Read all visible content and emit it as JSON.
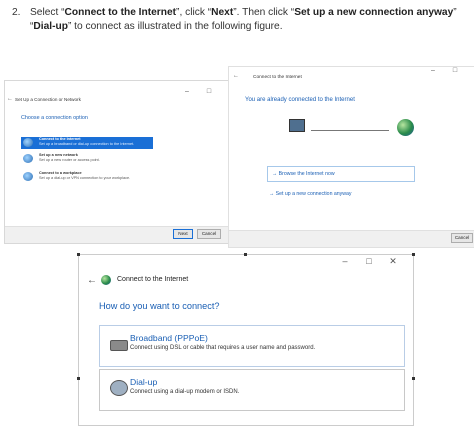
{
  "instruction": {
    "number": "2.",
    "p1": "Select “",
    "b1": "Connect to the Internet",
    "p2": "”, click “",
    "b2": "Next",
    "p3": "”. Then click “",
    "b3": "Set up a new connection anyway",
    "p4": "” “",
    "b4": "Dial-up",
    "p5": "” to connect as illustrated in the following figure."
  },
  "window_a": {
    "title": "Set Up a Connection or Network",
    "heading": "Choose a connection option",
    "options": [
      {
        "title": "Connect to the Internet",
        "desc": "Set up a broadband or dial-up connection to the Internet."
      },
      {
        "title": "Set up a new network",
        "desc": "Set up a new router or access point."
      },
      {
        "title": "Connect to a workplace",
        "desc": "Set up a dial-up or VPN connection to your workplace."
      }
    ],
    "next_label": "Next",
    "cancel_label": "Cancel"
  },
  "window_b": {
    "title": "Connect to the Internet",
    "status": "You are already connected to the Internet",
    "browse_label": "Browse the Internet now",
    "setup_label": "Set up a new connection anyway",
    "cancel_label": "Cancel"
  },
  "window_c": {
    "title": "Connect to the Internet",
    "heading": "How do you want to connect?",
    "choices": [
      {
        "title": "Broadband (PPPoE)",
        "desc": "Connect using DSL or cable that requires a user name and password."
      },
      {
        "title": "Dial-up",
        "desc": "Connect using a dial-up modem or ISDN."
      }
    ]
  },
  "window_controls": {
    "minimize": "–",
    "maximize": "□",
    "close": "✕"
  },
  "icons": [
    "back-arrow-icon",
    "network-globe-icon",
    "computer-icon",
    "broadband-modem-icon",
    "dialup-modem-icon"
  ]
}
